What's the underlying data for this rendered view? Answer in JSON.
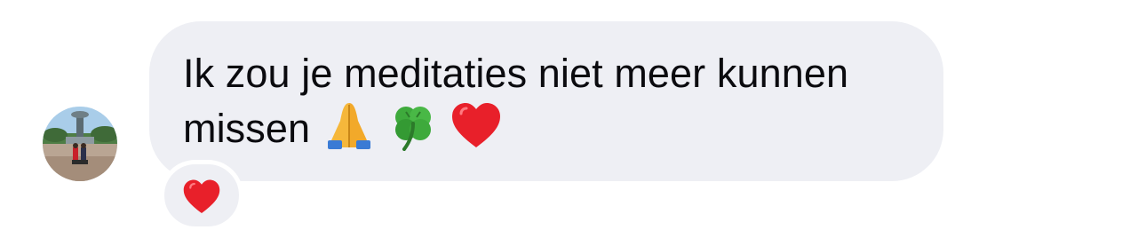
{
  "message": {
    "line1": "Ik zou je meditaties niet meer kunnen",
    "line2": "missen",
    "emojis": [
      "folded-hands",
      "four-leaf-clover",
      "red-heart"
    ],
    "bubble_color": "#eeeff4",
    "text_color": "#0b0b0f"
  },
  "reaction": {
    "emoji": "red-heart",
    "color": "#e8202a"
  }
}
